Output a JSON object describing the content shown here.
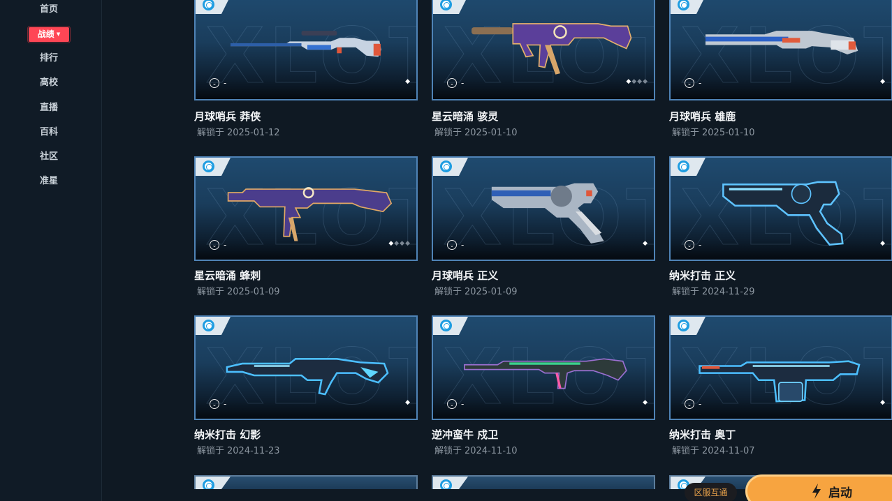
{
  "sidebar": {
    "items": [
      {
        "label": "首页",
        "active": false
      },
      {
        "label": "战绩",
        "active": true
      },
      {
        "label": "排行",
        "active": false
      },
      {
        "label": "高校",
        "active": false
      },
      {
        "label": "直播",
        "active": false
      },
      {
        "label": "百科",
        "active": false
      },
      {
        "label": "社区",
        "active": false
      },
      {
        "label": "准星",
        "active": false
      }
    ],
    "active_caret": "▼"
  },
  "card_common": {
    "level_text": "-",
    "watermark": "XLOT",
    "date_prefix": "解锁于"
  },
  "cards": [
    {
      "name": "月球哨兵 莽侠",
      "date": "2025-01-12",
      "levels_total": 1,
      "levels_on": 1
    },
    {
      "name": "星云暗涌 骇灵",
      "date": "2025-01-10",
      "levels_total": 4,
      "levels_on": 1
    },
    {
      "name": "月球哨兵 雄鹿",
      "date": "2025-01-10",
      "levels_total": 1,
      "levels_on": 1
    },
    {
      "name": "星云暗涌 蜂刺",
      "date": "2025-01-09",
      "levels_total": 4,
      "levels_on": 1
    },
    {
      "name": "月球哨兵 正义",
      "date": "2025-01-09",
      "levels_total": 1,
      "levels_on": 1
    },
    {
      "name": "纳米打击 正义",
      "date": "2024-11-29",
      "levels_total": 1,
      "levels_on": 1
    },
    {
      "name": "纳米打击 幻影",
      "date": "2024-11-23",
      "levels_total": 1,
      "levels_on": 1
    },
    {
      "name": "逆冲蛮牛 戍卫",
      "date": "2024-11-10",
      "levels_total": 1,
      "levels_on": 1
    },
    {
      "name": "纳米打击 奥丁",
      "date": "2024-11-07",
      "levels_total": 1,
      "levels_on": 1
    }
  ],
  "footer": {
    "region_label": "区服互通",
    "launch_label": "启动"
  },
  "colors": {
    "accent_red": "#ff4655",
    "card_border": "#4f83b6",
    "launch_orange": "#f7a440"
  }
}
